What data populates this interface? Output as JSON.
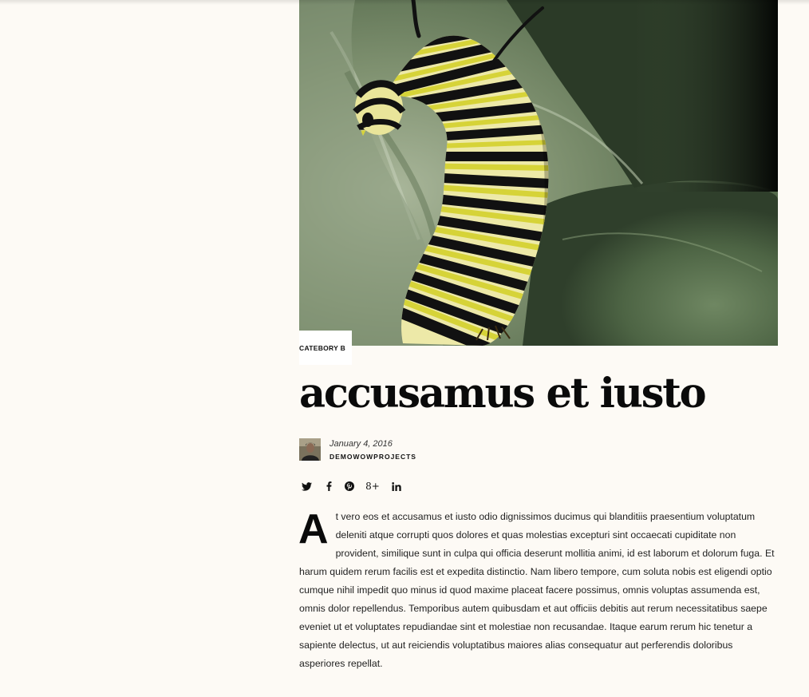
{
  "post": {
    "category": "CATEBORY B",
    "title": "accusamus et iusto",
    "date": "January 4, 2016",
    "author": "DEMOWOWPROJECTS",
    "dropcap": "A",
    "body": "t vero eos et accusamus et iusto odio dignissimos ducimus qui blanditiis praesentium voluptatum deleniti atque corrupti quos dolores et quas molestias excepturi sint occaecati cupiditate non provident, similique sunt in culpa qui officia deserunt mollitia animi, id est laborum et dolorum fuga. Et harum quidem rerum facilis est et expedita distinctio. Nam libero tempore, cum soluta nobis est eligendi optio cumque nihil impedit quo minus id quod maxime placeat facere possimus, omnis voluptas assumenda est, omnis dolor repellendus. Temporibus autem quibusdam et aut officiis debitis aut rerum necessitatibus saepe eveniet ut et voluptates repudiandae sint et molestiae non recusandae. Itaque earum rerum hic tenetur a sapiente delectus, ut aut reiciendis voluptatibus maiores alias consequatur aut perferendis doloribus asperiores repellat."
  },
  "share": {
    "icons": [
      "twitter-icon",
      "facebook-icon",
      "pinterest-icon",
      "google-plus-icon",
      "linkedin-icon"
    ],
    "google_plus_glyph": "8+"
  },
  "colors": {
    "background": "#fdfaf5",
    "text": "#111111",
    "leaf": "#5b7250",
    "caterpillar_yellow": "#d8d63a"
  }
}
